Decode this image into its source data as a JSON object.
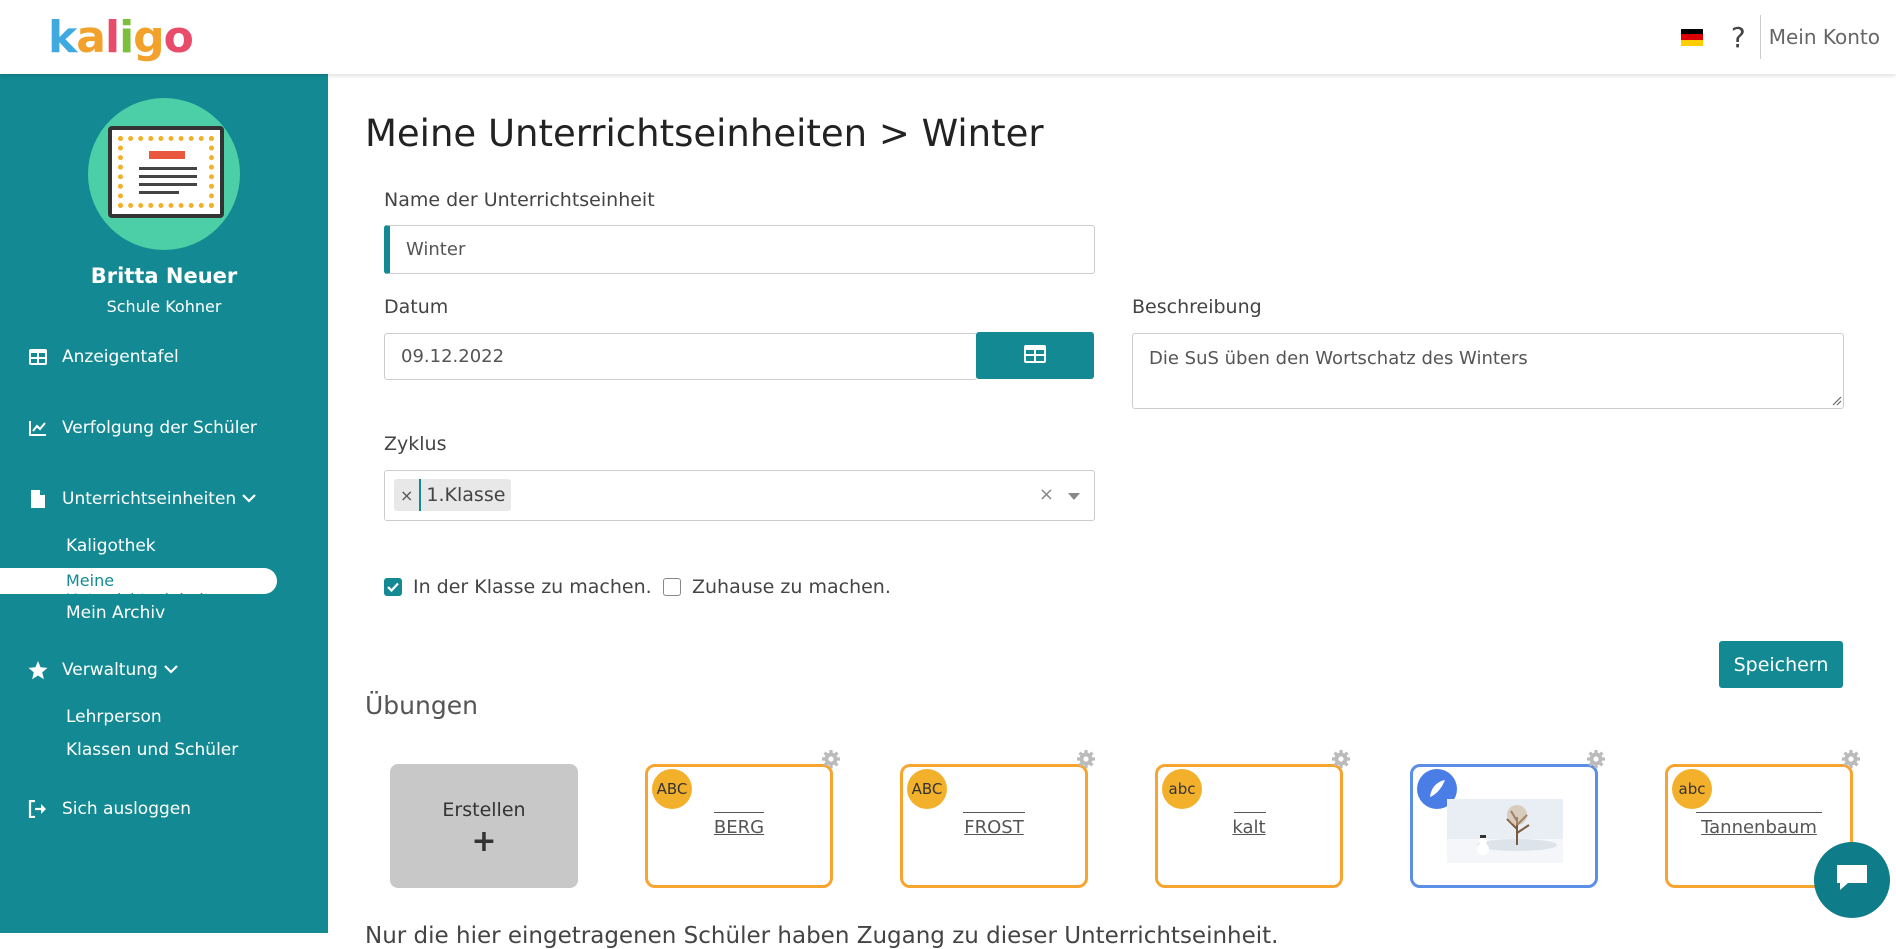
{
  "app": {
    "logo_letters": [
      "k",
      "a",
      "l",
      "i",
      "g",
      "o"
    ],
    "logo_colors": [
      "#3fa9e0",
      "#f2a22a",
      "#e94b6a",
      "#7cbf3a",
      "#f2a22a",
      "#e94b6a"
    ]
  },
  "topbar": {
    "help_label": "?",
    "account_label": "Mein Konto",
    "flag_colors": [
      "#000000",
      "#dd0000",
      "#ffce00"
    ]
  },
  "sidebar": {
    "user_name": "Britta Neuer",
    "school": "Schule Kohner",
    "nav": {
      "dashboard": "Anzeigentafel",
      "tracking": "Verfolgung der Schüler",
      "units": "Unterrichtseinheiten",
      "units_sub": [
        "Kaligothek",
        "Meine Unterrichtseinheiten",
        "Mein Archiv"
      ],
      "admin": "Verwaltung",
      "admin_sub": [
        "Lehrperson",
        "Klassen und Schüler"
      ],
      "logout": "Sich ausloggen"
    }
  },
  "main": {
    "title": "Meine Unterrichtseinheiten > Winter",
    "name_label": "Name der Unterrichtseinheit",
    "name_value": "Winter",
    "date_label": "Datum",
    "date_value": "09.12.2022",
    "description_label": "Beschreibung",
    "description_value": "Die SuS üben den Wortschatz des Winters",
    "cycle_label": "Zyklus",
    "cycle_tag": "1.Klasse",
    "tag_remove": "×",
    "select_clear": "×",
    "check_class_label": "In der Klasse zu machen.",
    "check_class_checked": true,
    "check_home_label": "Zuhause zu machen.",
    "check_home_checked": false,
    "save_label": "Speichern",
    "exercises_title": "Übungen",
    "create_label": "Erstellen",
    "create_plus": "+",
    "exercises": [
      {
        "badge": "ABC",
        "word": "BERG",
        "type": "word"
      },
      {
        "badge": "ABC",
        "word": "FROST",
        "type": "word"
      },
      {
        "badge": "abc",
        "word": "kalt",
        "type": "word"
      },
      {
        "badge": "",
        "word": "",
        "type": "image"
      },
      {
        "badge": "abc",
        "word": "Tannenbaum",
        "type": "word"
      }
    ],
    "bottom_text": "Nur die hier eingetragenen Schüler haben Zugang zu dieser Unterrichtseinheit."
  },
  "colors": {
    "accent": "#138a93",
    "card_orange": "#f7a431",
    "card_blue": "#5b8ee6",
    "badge_yellow": "#f3b02a"
  }
}
